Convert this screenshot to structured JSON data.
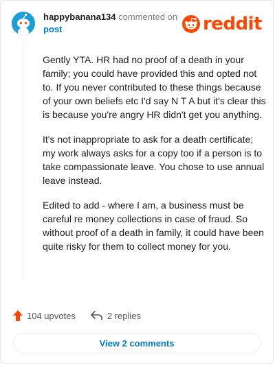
{
  "comment": {
    "username": "happybanana134",
    "action_text": "commented on",
    "post_link": "post",
    "paragraphs": [
      "Gently YTA. HR had no proof of a death in your family; you could have provided this and opted not to. If you never contributed to these things because of your own beliefs etc I'd say N T A but it's clear this is because you're angry HR didn't get you anything.",
      "It's not inappropriate to ask for a death certificate; my work always asks for a copy too if a person is to take compassionate leave. You chose to use annual leave instead.",
      "Edited to add - where I am, a business must be careful re money collections in case of fraud. So without proof of a death in family, it could have been quite risky for them to collect money for you."
    ],
    "upvotes_label": "104 upvotes",
    "replies_label": "2 replies"
  },
  "brand": {
    "name": "reddit",
    "accent": "#ff4500"
  },
  "footer": {
    "view_comments_label": "View 2 comments"
  },
  "icons": {
    "avatar": "snoo-avatar-icon",
    "logo": "reddit-logo-icon",
    "upvote": "upvote-arrow-icon",
    "reply": "reply-arrow-icon"
  }
}
